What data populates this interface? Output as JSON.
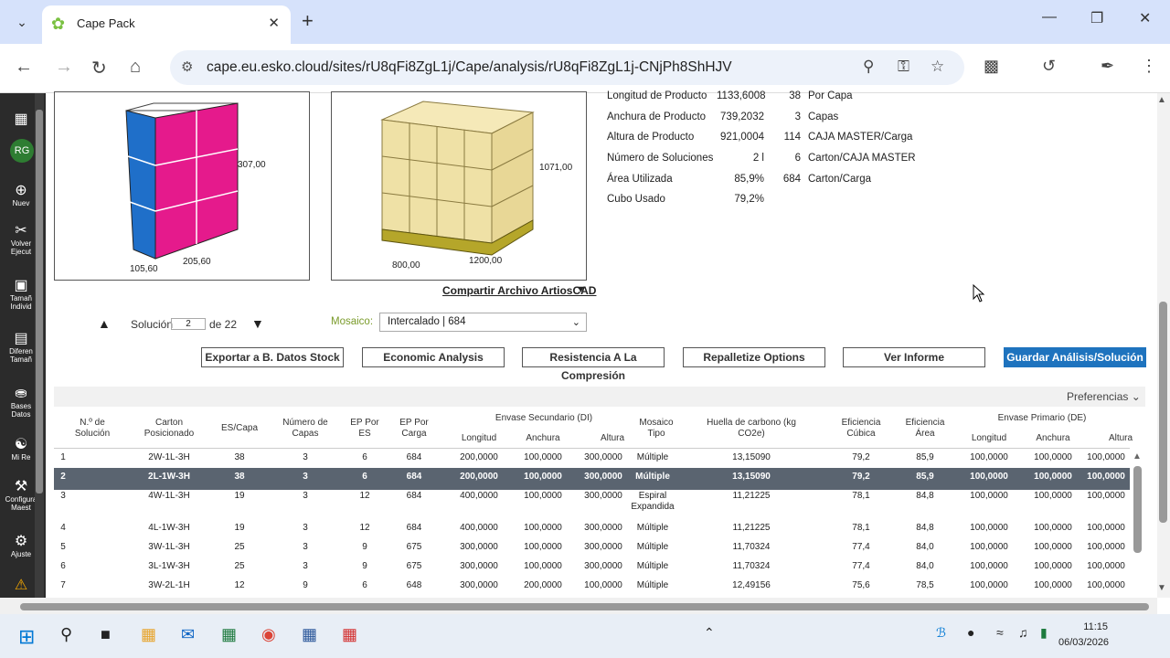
{
  "browser": {
    "tab_title": "Cape Pack",
    "url": "cape.eu.esko.cloud/sites/rU8qFi8ZgL1j/Cape/analysis/rU8qFi8ZgL1j-CNjPh8ShHJV"
  },
  "sidebar": {
    "avatar": "RG",
    "items": [
      {
        "label": "Nuev"
      },
      {
        "label": "Volver Ejecut"
      },
      {
        "label": "Tamañ Individ"
      },
      {
        "label": "Diferen Tamañ"
      },
      {
        "label": "Bases Datos"
      },
      {
        "label": "Mi Re"
      },
      {
        "label": "Configura Maest"
      },
      {
        "label": "Ajuste"
      }
    ]
  },
  "dims": {
    "case_h": "307,00",
    "case_l": "105,60",
    "case_w": "205,60",
    "pal_h": "1071,00",
    "pal_l": "800,00",
    "pal_w": "1200,00"
  },
  "stats": {
    "rows": [
      {
        "label": "Longitud de Producto",
        "value": "1133,6008",
        "n": "38",
        "u": "Por Capa"
      },
      {
        "label": "Anchura de Producto",
        "value": "739,2032",
        "n": "3",
        "u": "Capas"
      },
      {
        "label": "Altura de Producto",
        "value": "921,0004",
        "n": "114",
        "u": "CAJA MASTER/Carga"
      },
      {
        "label": "Número de Soluciones",
        "value": "2 l",
        "n": "6",
        "u": "Carton/CAJA MASTER"
      },
      {
        "label": "Área Utilizada",
        "value": "85,9%",
        "n": "684",
        "u": "Carton/Carga"
      },
      {
        "label": "Cubo Usado",
        "value": "79,2%",
        "n": "",
        "u": ""
      }
    ]
  },
  "share_link": "Compartir Archivo ArtiosCAD",
  "solution": {
    "label": "Solución",
    "value": "2",
    "of": "de 22"
  },
  "mosaic": {
    "label": "Mosaico:",
    "value": "Intercalado | 684"
  },
  "buttons": {
    "export": "Exportar a B. Datos Stock",
    "economic": "Economic Analysis",
    "resist": "Resistencia A La Compresión",
    "repal": "Repalletize Options",
    "report": "Ver Informe",
    "save": "Guardar Análisis/Solución"
  },
  "preferences": "Preferencias",
  "table": {
    "h_sol": "N.º de Solución",
    "h_carton": "Carton Posicionado",
    "h_escapa": "ES/Capa",
    "h_capas": "Número de Capas",
    "h_epes": "EP Por ES",
    "h_epcarga": "EP Por Carga",
    "h_es": "Envase Secundario (DI)",
    "h_long": "Longitud",
    "h_anch": "Anchura",
    "h_alt": "Altura",
    "h_mos": "Mosaico Tipo",
    "h_huella": "Huella de carbono (kg CO2e)",
    "h_efc": "Eficiencia Cúbica",
    "h_efa": "Eficiencia Área",
    "h_ep": "Envase Primario (DE)",
    "h_long2": "Longitud",
    "h_anch2": "Anchura",
    "h_alt2": "Altura",
    "rows": [
      [
        "1",
        "2W-1L-3H",
        "38",
        "3",
        "6",
        "684",
        "200,0000",
        "100,0000",
        "300,0000",
        "Múltiple",
        "13,15090",
        "79,2",
        "85,9",
        "100,0000",
        "100,0000",
        "100,0000"
      ],
      [
        "2",
        "2L-1W-3H",
        "38",
        "3",
        "6",
        "684",
        "200,0000",
        "100,0000",
        "300,0000",
        "Múltiple",
        "13,15090",
        "79,2",
        "85,9",
        "100,0000",
        "100,0000",
        "100,0000"
      ],
      [
        "3",
        "4W-1L-3H",
        "19",
        "3",
        "12",
        "684",
        "400,0000",
        "100,0000",
        "300,0000",
        "Espiral Expandida",
        "11,21225",
        "78,1",
        "84,8",
        "100,0000",
        "100,0000",
        "100,0000"
      ],
      [
        "4",
        "4L-1W-3H",
        "19",
        "3",
        "12",
        "684",
        "400,0000",
        "100,0000",
        "300,0000",
        "Múltiple",
        "11,21225",
        "78,1",
        "84,8",
        "100,0000",
        "100,0000",
        "100,0000"
      ],
      [
        "5",
        "3W-1L-3H",
        "25",
        "3",
        "9",
        "675",
        "300,0000",
        "100,0000",
        "300,0000",
        "Múltiple",
        "11,70324",
        "77,4",
        "84,0",
        "100,0000",
        "100,0000",
        "100,0000"
      ],
      [
        "6",
        "3L-1W-3H",
        "25",
        "3",
        "9",
        "675",
        "300,0000",
        "100,0000",
        "300,0000",
        "Múltiple",
        "11,70324",
        "77,4",
        "84,0",
        "100,0000",
        "100,0000",
        "100,0000"
      ],
      [
        "7",
        "3W-2L-1H",
        "12",
        "9",
        "6",
        "648",
        "300,0000",
        "200,0000",
        "100,0000",
        "Múltiple",
        "12,49156",
        "75,6",
        "78,5",
        "100,0000",
        "100,0000",
        "100,0000"
      ]
    ]
  },
  "taskbar": {
    "time": "11:15",
    "date": "06/03/2026"
  }
}
